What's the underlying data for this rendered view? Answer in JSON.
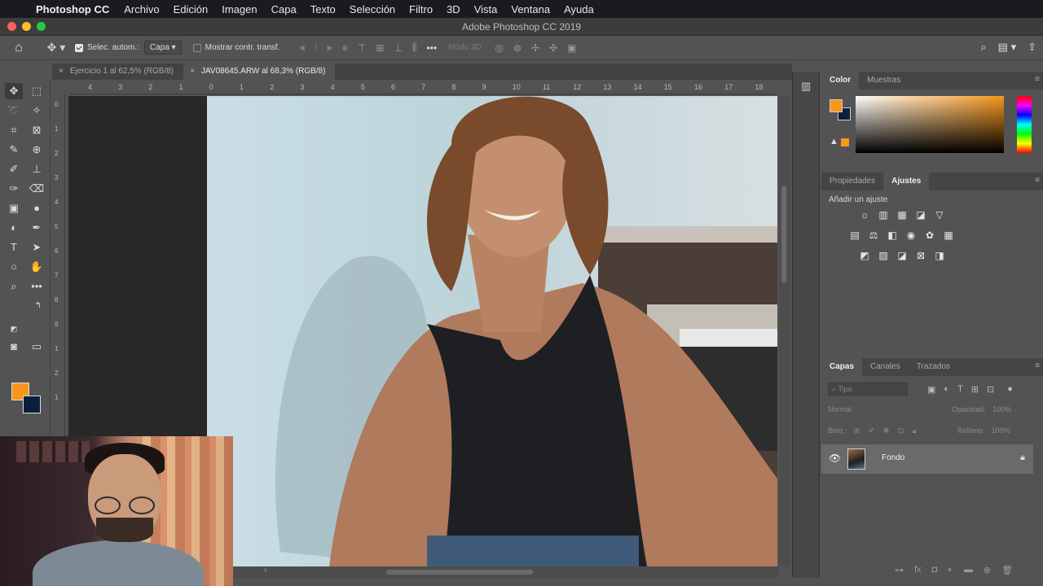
{
  "menubar": {
    "app_name": "Photoshop CC",
    "menus": [
      "Archivo",
      "Edición",
      "Imagen",
      "Capa",
      "Texto",
      "Selección",
      "Filtro",
      "3D",
      "Vista",
      "Ventana",
      "Ayuda"
    ]
  },
  "window": {
    "title": "Adobe Photoshop CC 2019"
  },
  "options_bar": {
    "auto_select_label": "Selec. autom.:",
    "auto_select_value": "Capa",
    "show_transform_label": "Mostrar contr. transf.",
    "mode_3d_label": "Modo 3D:"
  },
  "tabs": [
    {
      "label": "Ejercicio 1 al 62,5% (RGB/8)"
    },
    {
      "label": "JAV08645.ARW al 68,3% (RGB/8)"
    }
  ],
  "hruler_labels": [
    "4",
    "3",
    "2",
    "1",
    "0",
    "1",
    "2",
    "3",
    "4",
    "5",
    "6",
    "7",
    "8",
    "9",
    "10",
    "11",
    "12",
    "13",
    "14",
    "15",
    "16",
    "17",
    "18"
  ],
  "vruler_labels": [
    "0",
    "1",
    "2",
    "3",
    "4",
    "5",
    "6",
    "7",
    "8",
    "9",
    "1",
    "2",
    "1"
  ],
  "colors": {
    "foreground": "#f7961b",
    "background": "#0b1f3d"
  },
  "color_panel": {
    "tabs": [
      "Color",
      "Muestras"
    ]
  },
  "adjust_panel": {
    "tabs": [
      "Propiedades",
      "Ajustes"
    ],
    "add_adjustment_label": "Añadir un ajuste"
  },
  "layers_panel": {
    "tabs": [
      "Capas",
      "Canales",
      "Trazados"
    ],
    "search_placeholder": "Tipo",
    "blend_mode": "Normal",
    "opacity_label": "Opacidad:",
    "opacity_value": "100%",
    "lock_label": "Bloq.:",
    "fill_label": "Relleno:",
    "fill_value": "100%",
    "layers": [
      {
        "name": "Fondo"
      }
    ]
  }
}
